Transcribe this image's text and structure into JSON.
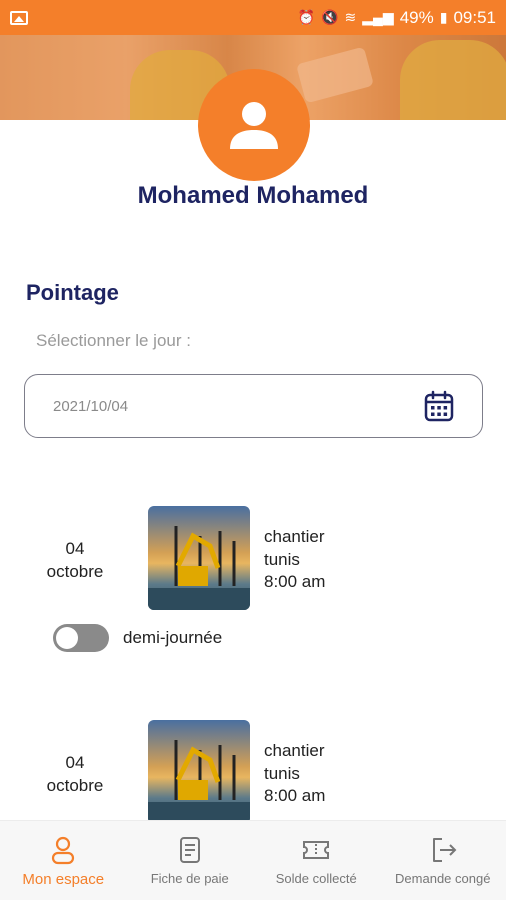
{
  "status_bar": {
    "battery": "49%",
    "time": "09:51"
  },
  "profile": {
    "name": "Mohamed Mohamed"
  },
  "pointage": {
    "title": "Pointage",
    "select_label": "Sélectionner le jour :",
    "date_value": "2021/10/04"
  },
  "entries": [
    {
      "day": "04",
      "month": "octobre",
      "place": "chantier",
      "city": "tunis",
      "time": "8:00 am",
      "toggle_label": "demi-journée",
      "half_day": false
    },
    {
      "day": "04",
      "month": "octobre",
      "place": "chantier",
      "city": "tunis",
      "time": "8:00 am"
    }
  ],
  "bottom_nav": {
    "items": [
      {
        "label": "Mon espace",
        "icon": "user-icon",
        "active": true
      },
      {
        "label": "Fiche de paie",
        "icon": "document-icon",
        "active": false
      },
      {
        "label": "Solde collecté",
        "icon": "ticket-icon",
        "active": false
      },
      {
        "label": "Demande congé",
        "icon": "logout-icon",
        "active": false
      }
    ]
  },
  "colors": {
    "accent": "#f47f2a",
    "title": "#1e2462",
    "inactive": "#777777"
  }
}
